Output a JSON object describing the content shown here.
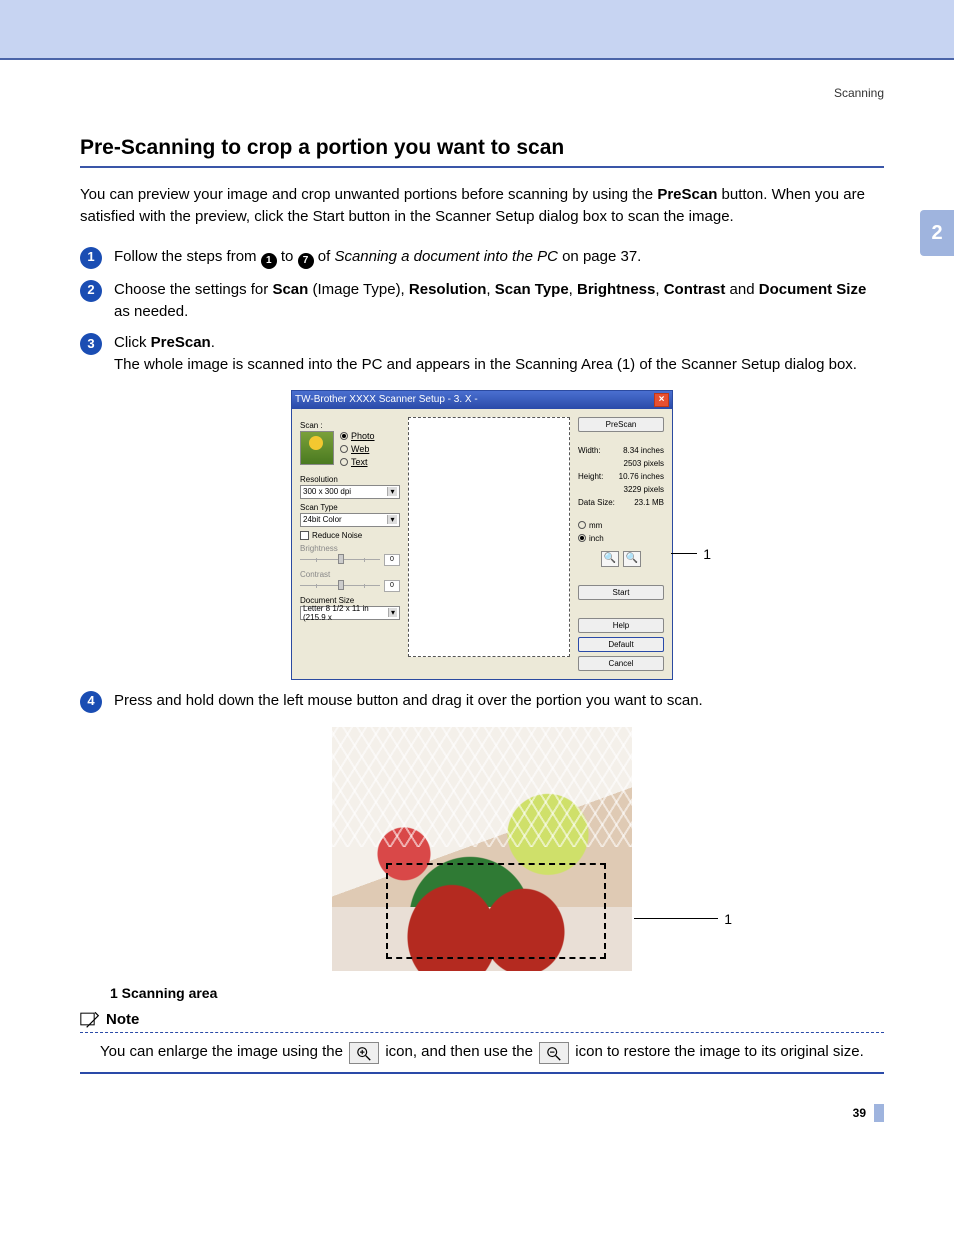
{
  "header": {
    "breadcrumb": "Scanning"
  },
  "chapter_tab": "2",
  "title": "Pre-Scanning to crop a portion you want to scan",
  "intro_parts": {
    "a": "You can preview your image and crop unwanted portions before scanning by using the ",
    "b": "PreScan",
    "c": " button. When you are satisfied with the preview, click the Start button in the Scanner Setup dialog box to scan the image."
  },
  "steps": [
    {
      "n": "1",
      "parts": {
        "a": "Follow the steps from ",
        "r1": "1",
        "b": " to ",
        "r7": "7",
        "c": " of ",
        "ital": "Scanning a document into the PC",
        "d": " on page 37."
      }
    },
    {
      "n": "2",
      "parts": {
        "a": "Choose the settings for ",
        "b1": "Scan",
        "a2": " (Image Type), ",
        "b2": "Resolution",
        "a3": ", ",
        "b3": "Scan Type",
        "a4": ", ",
        "b4": "Brightness",
        "a5": ", ",
        "b5": "Contrast",
        "a6": " and ",
        "b6": "Document Size",
        "a7": " as needed."
      }
    },
    {
      "n": "3",
      "parts": {
        "a": "Click ",
        "b": "PreScan",
        "c": ".",
        "d": "The whole image is scanned into the PC and appears in the Scanning Area (1) of the Scanner Setup dialog box."
      }
    },
    {
      "n": "4",
      "parts": {
        "a": "Press and hold down the left mouse button and drag it over the portion you want to scan."
      }
    }
  ],
  "dialog": {
    "title": "TW-Brother XXXX Scanner Setup - 3. X -",
    "scan_label": "Scan :",
    "radios": {
      "photo": "Photo",
      "web": "Web",
      "text": "Text"
    },
    "resolution_label": "Resolution",
    "resolution_value": "300 x 300 dpi",
    "scan_type_label": "Scan Type",
    "scan_type_value": "24bit Color",
    "reduce_noise": "Reduce Noise",
    "brightness_label": "Brightness",
    "brightness_value": "0",
    "contrast_label": "Contrast",
    "contrast_value": "0",
    "doc_size_label": "Document Size",
    "doc_size_value": "Letter 8 1/2 x 11 in (215.9 x",
    "btn_prescan": "PreScan",
    "width_label": "Width:",
    "width_value": "8.34 inches",
    "width_px": "2503 pixels",
    "height_label": "Height:",
    "height_value": "10.76 inches",
    "height_px": "3229 pixels",
    "datasize_label": "Data Size:",
    "datasize_value": "23.1 MB",
    "unit_mm": "mm",
    "unit_inch": "inch",
    "btn_start": "Start",
    "btn_help": "Help",
    "btn_default": "Default",
    "btn_cancel": "Cancel"
  },
  "callouts": {
    "one_a": "1",
    "one_b": "1"
  },
  "caption": "1   Scanning area",
  "note": {
    "title": "Note",
    "a": "You can enlarge the image using the ",
    "b": " icon, and then use the ",
    "c": " icon to restore the image to its original size."
  },
  "page_number": "39"
}
